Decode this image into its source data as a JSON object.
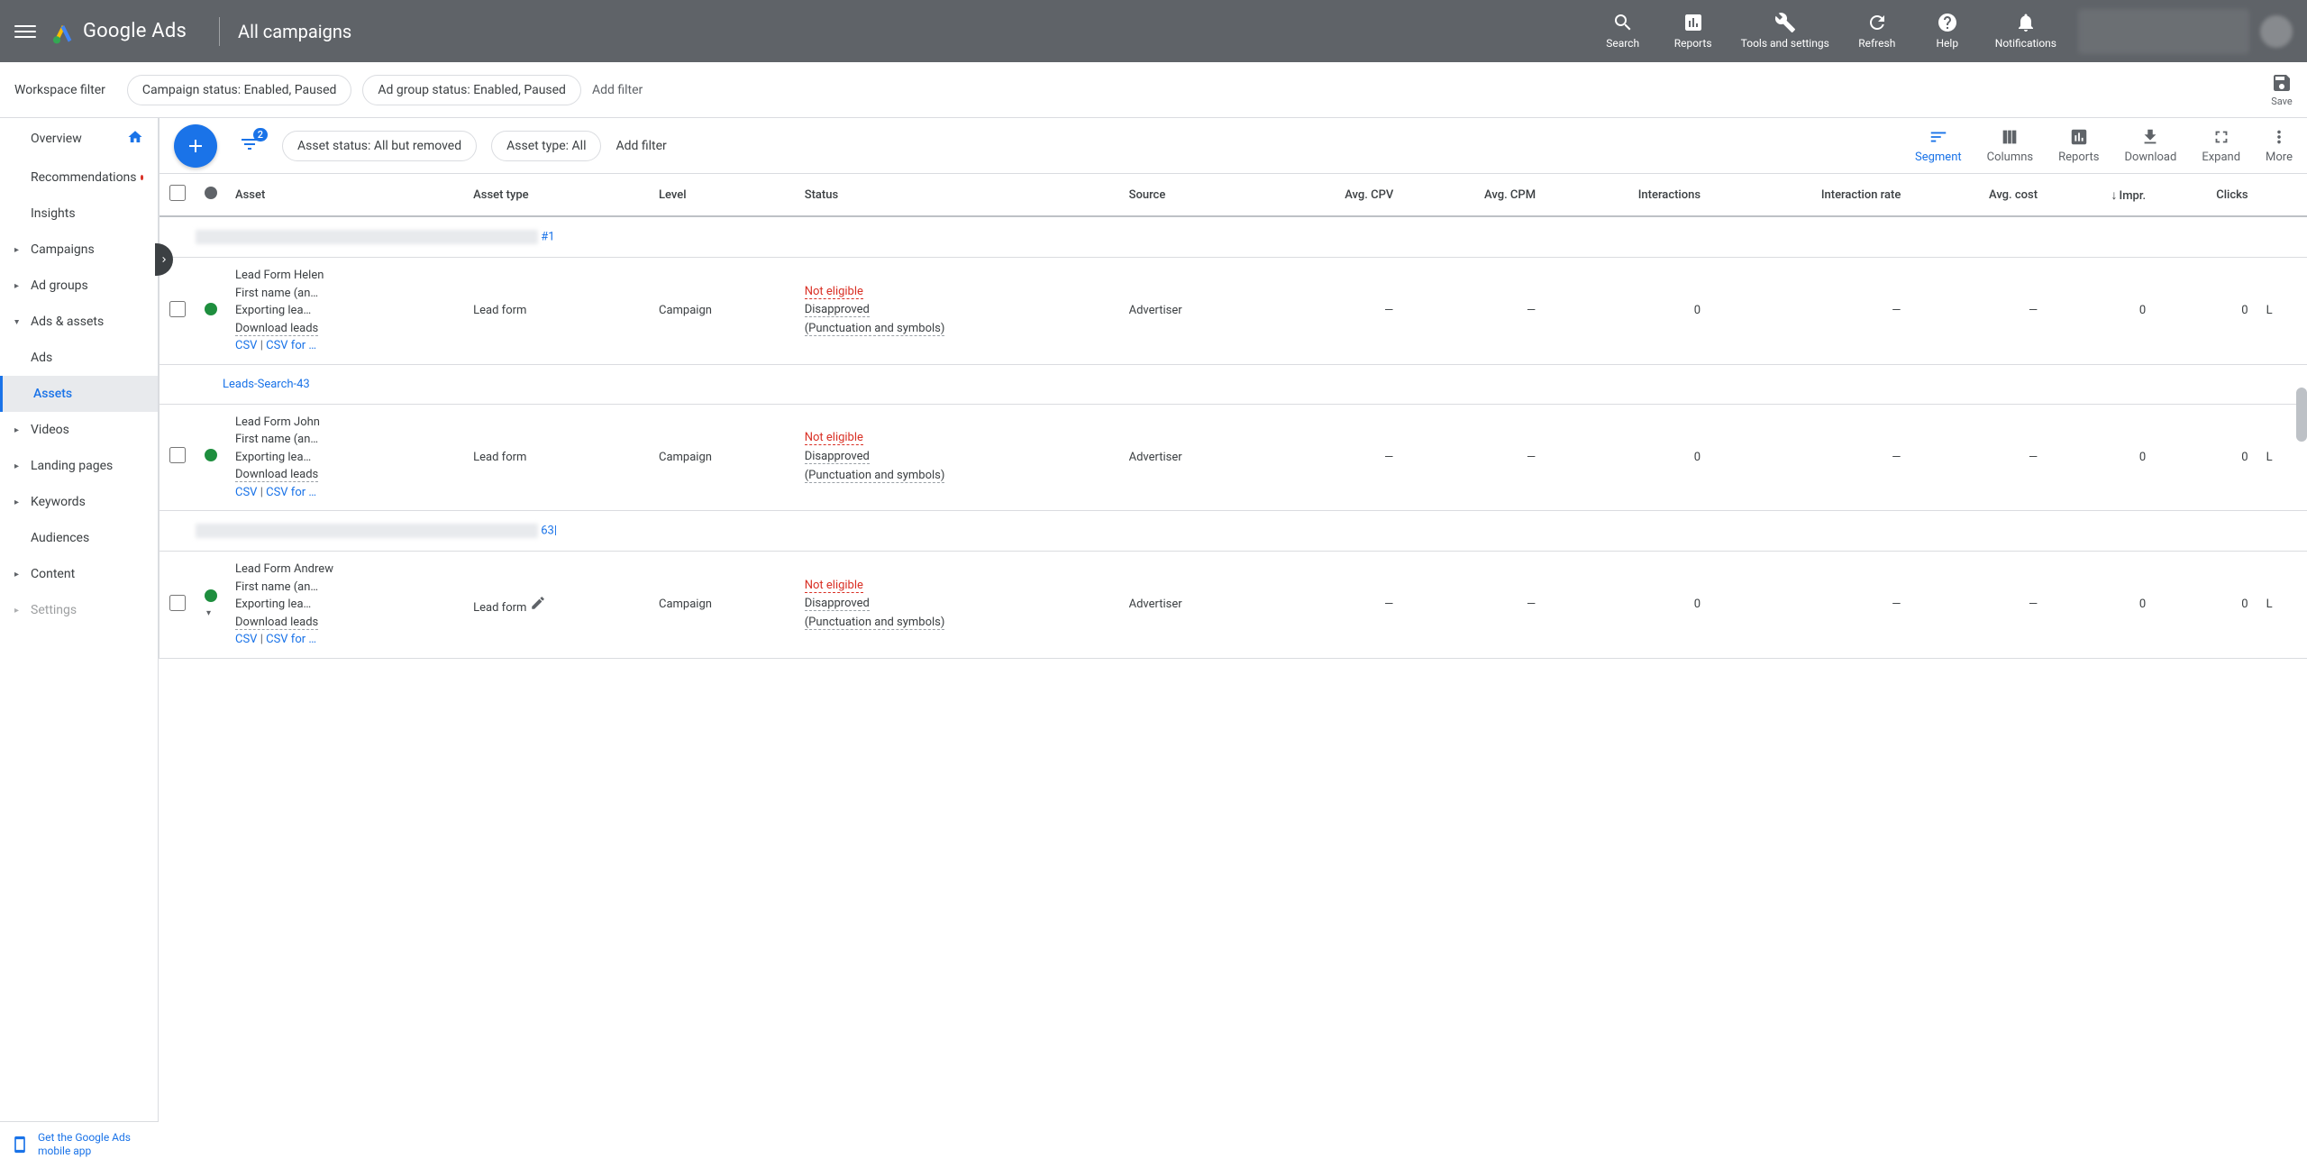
{
  "header": {
    "brand": "Google Ads",
    "page_title": "All campaigns",
    "actions": {
      "search": "Search",
      "reports": "Reports",
      "tools": "Tools and settings",
      "refresh": "Refresh",
      "help": "Help",
      "notifications": "Notifications"
    }
  },
  "workspace_filter": {
    "label": "Workspace filter",
    "chips": {
      "campaign_status": "Campaign status: Enabled, Paused",
      "ad_group_status": "Ad group status: Enabled, Paused"
    },
    "add_filter": "Add filter",
    "save": "Save"
  },
  "sidebar": {
    "overview": "Overview",
    "recommendations": "Recommendations",
    "insights": "Insights",
    "campaigns": "Campaigns",
    "ad_groups": "Ad groups",
    "ads_assets": "Ads & assets",
    "ads": "Ads",
    "assets": "Assets",
    "videos": "Videos",
    "landing_pages": "Landing pages",
    "keywords": "Keywords",
    "audiences": "Audiences",
    "content": "Content",
    "settings": "Settings"
  },
  "content_toolbar": {
    "filter_count": "2",
    "asset_status_chip": "Asset status: All but removed",
    "asset_type_chip": "Asset type: All",
    "add_filter": "Add filter",
    "tools": {
      "segment": "Segment",
      "columns": "Columns",
      "reports": "Reports",
      "download": "Download",
      "expand": "Expand",
      "more": "More"
    }
  },
  "table": {
    "columns": {
      "asset": "Asset",
      "asset_type": "Asset type",
      "level": "Level",
      "status": "Status",
      "source": "Source",
      "avg_cpv": "Avg. CPV",
      "avg_cpm": "Avg. CPM",
      "interactions": "Interactions",
      "interaction_rate": "Interaction rate",
      "avg_cost": "Avg. cost",
      "impr": "Impr.",
      "clicks": "Clicks"
    },
    "groups": [
      {
        "label_suffix": "#1"
      },
      {
        "label_full": "Leads-Search-43"
      },
      {
        "label_suffix": "63|"
      }
    ],
    "rows": [
      {
        "asset_title": "Lead Form Helen",
        "first_name": "First name (an…",
        "exporting": "Exporting lea…",
        "download_leads": "Download leads",
        "csv": "CSV",
        "csv_for": "CSV for …",
        "asset_type": "Lead form",
        "level": "Campaign",
        "status_main": "Not eligible",
        "status_sub1": "Disapproved",
        "status_sub2": "(Punctuation and symbols)",
        "source": "Advertiser",
        "avg_cpv": "—",
        "avg_cpm": "—",
        "interactions": "0",
        "interaction_rate": "—",
        "avg_cost": "—",
        "impr": "0",
        "clicks": "0",
        "has_edit": false
      },
      {
        "asset_title": "Lead Form John",
        "first_name": "First name (an…",
        "exporting": "Exporting lea…",
        "download_leads": "Download leads",
        "csv": "CSV",
        "csv_for": "CSV for …",
        "asset_type": "Lead form",
        "level": "Campaign",
        "status_main": "Not eligible",
        "status_sub1": "Disapproved",
        "status_sub2": "(Punctuation and symbols)",
        "source": "Advertiser",
        "avg_cpv": "—",
        "avg_cpm": "—",
        "interactions": "0",
        "interaction_rate": "—",
        "avg_cost": "—",
        "impr": "0",
        "clicks": "0",
        "has_edit": false
      },
      {
        "asset_title": "Lead Form Andrew",
        "first_name": "First name (an…",
        "exporting": "Exporting lea…",
        "download_leads": "Download leads",
        "csv": "CSV",
        "csv_for": "CSV for …",
        "asset_type": "Lead form",
        "level": "Campaign",
        "status_main": "Not eligible",
        "status_sub1": "Disapproved",
        "status_sub2": "(Punctuation and symbols)",
        "source": "Advertiser",
        "avg_cpv": "—",
        "avg_cpm": "—",
        "interactions": "0",
        "interaction_rate": "—",
        "avg_cost": "—",
        "impr": "0",
        "clicks": "0",
        "has_edit": true
      }
    ]
  },
  "mobile_promo": "Get the Google Ads mobile app"
}
